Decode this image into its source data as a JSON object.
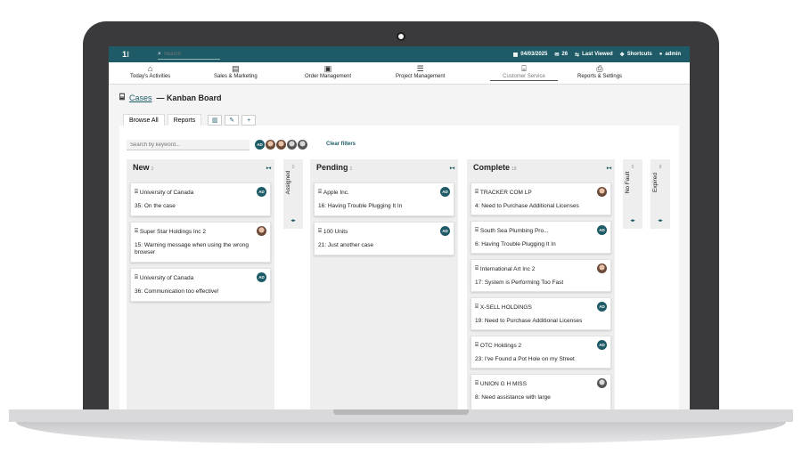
{
  "topbar": {
    "search_placeholder": "Search",
    "date": "04/03/2025",
    "mail_count": "26",
    "last_viewed": "Last Viewed",
    "shortcuts": "Shortcuts",
    "user": "admin"
  },
  "nav": {
    "items": [
      {
        "label": "Today's Activities",
        "icon": "home-icon"
      },
      {
        "label": "Sales & Marketing",
        "icon": "store-icon"
      },
      {
        "label": "Order Management",
        "icon": "clipboard-icon"
      },
      {
        "label": "Project Management",
        "icon": "list-icon"
      },
      {
        "label": "Customer Service",
        "icon": "inbox-icon"
      },
      {
        "label": "Reports & Settings",
        "icon": "printer-icon"
      }
    ]
  },
  "header": {
    "link": "Cases",
    "title": "— Kanban Board"
  },
  "tabs": {
    "browse": "Browse All",
    "reports": "Reports",
    "plus": "+"
  },
  "filters": {
    "keyword_placeholder": "Search by keyword...",
    "clear": "Clear filters",
    "avatar_initials": "AD"
  },
  "columns": {
    "new": {
      "name": "New",
      "count": "3",
      "cards": [
        {
          "company": "University of Canada",
          "title": "35: On the case",
          "owner": "AD"
        },
        {
          "company": "Super Star Holdings Inc 2",
          "title": "15: Warning message when using the wrong browser",
          "owner": "photo"
        },
        {
          "company": "University of Canada",
          "title": "36: Communication too effective!",
          "owner": "AD"
        }
      ]
    },
    "assigned": {
      "name": "Assigned",
      "count": "0"
    },
    "pending": {
      "name": "Pending",
      "count": "2",
      "cards": [
        {
          "company": "Apple Inc.",
          "title": "16: Having Trouble Plugging It In",
          "owner": "AD"
        },
        {
          "company": "100 Units",
          "title": "21: Just another case",
          "owner": "AD"
        }
      ]
    },
    "complete": {
      "name": "Complete",
      "count": "18",
      "cards": [
        {
          "company": "TRACKER COM LP",
          "title": "4: Need to Purchase Additional Licenses",
          "owner": "photo"
        },
        {
          "company": "South Sea Plumbing Pro...",
          "title": "6: Having Trouble Plugging It In",
          "owner": "AD"
        },
        {
          "company": "International Art Inc 2",
          "title": "17: System is Performing Too Fast",
          "owner": "photo"
        },
        {
          "company": "X-SELL HOLDINGS",
          "title": "19: Need to Purchase Additional Licenses",
          "owner": "AD"
        },
        {
          "company": "OTC Holdings 2",
          "title": "23: I've Found a Pot Hole on my Street",
          "owner": "AD"
        },
        {
          "company": "UNION G H MISS",
          "title": "8: Need assistance with large",
          "owner": "photo"
        }
      ]
    },
    "no_fault": {
      "name": "No Fault",
      "count": "5"
    },
    "expired": {
      "name": "Expired",
      "count": "8"
    }
  },
  "colors": {
    "accent": "#1e5b67",
    "frame": "#3a3a3c"
  }
}
